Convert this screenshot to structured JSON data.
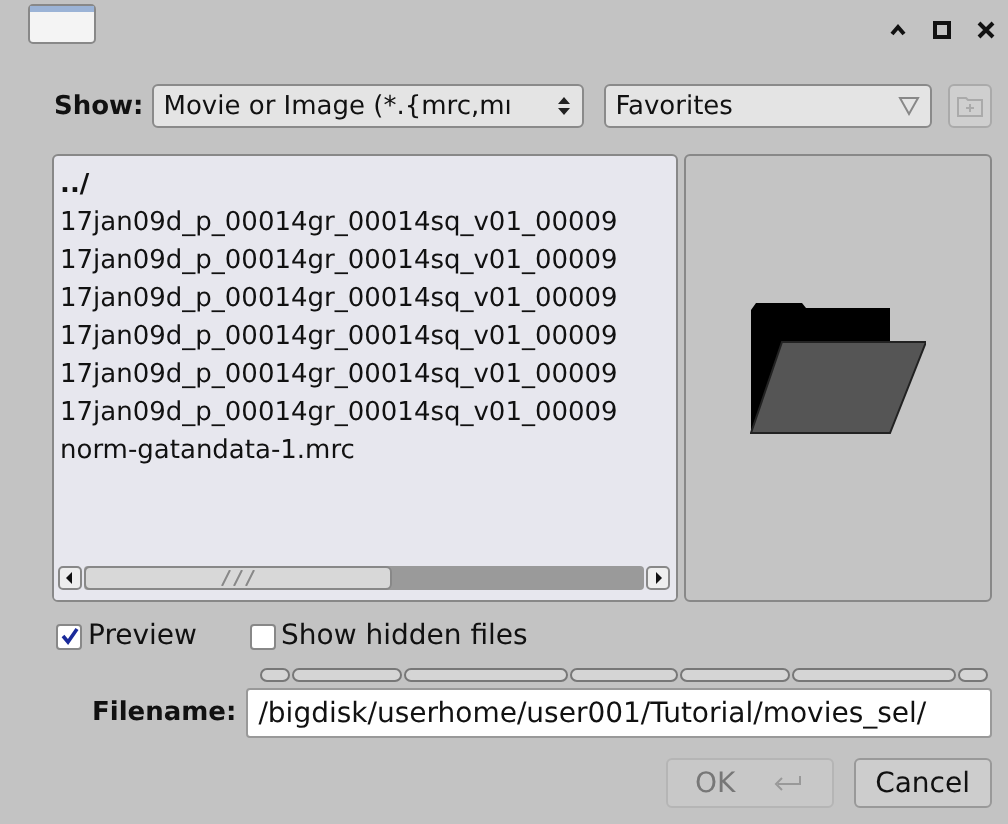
{
  "toolbar": {
    "show_label": "Show:",
    "filter": "Movie or Image (*.{mrc,mı",
    "location": "Favorites",
    "new_folder_disabled": true
  },
  "files": [
    {
      "name": "../",
      "kind": "dir"
    },
    {
      "name": "17jan09d_p_00014gr_00014sq_v01_00009",
      "kind": "file"
    },
    {
      "name": "17jan09d_p_00014gr_00014sq_v01_00009",
      "kind": "file"
    },
    {
      "name": "17jan09d_p_00014gr_00014sq_v01_00009",
      "kind": "file"
    },
    {
      "name": "17jan09d_p_00014gr_00014sq_v01_00009",
      "kind": "file"
    },
    {
      "name": "17jan09d_p_00014gr_00014sq_v01_00009",
      "kind": "file"
    },
    {
      "name": "17jan09d_p_00014gr_00014sq_v01_00009",
      "kind": "file"
    },
    {
      "name": "norm-gatandata-1.mrc",
      "kind": "file"
    }
  ],
  "options": [
    {
      "label": "Preview",
      "checked": true
    },
    {
      "label": "Show hidden files",
      "checked": false
    }
  ],
  "filename": {
    "label": "Filename:",
    "value": "/bigdisk/userhome/user001/Tutorial/movies_sel/"
  },
  "buttons": [
    {
      "label": "OK",
      "disabled": true,
      "kind": "ok"
    },
    {
      "label": "Cancel",
      "disabled": false,
      "kind": "cancel"
    }
  ]
}
